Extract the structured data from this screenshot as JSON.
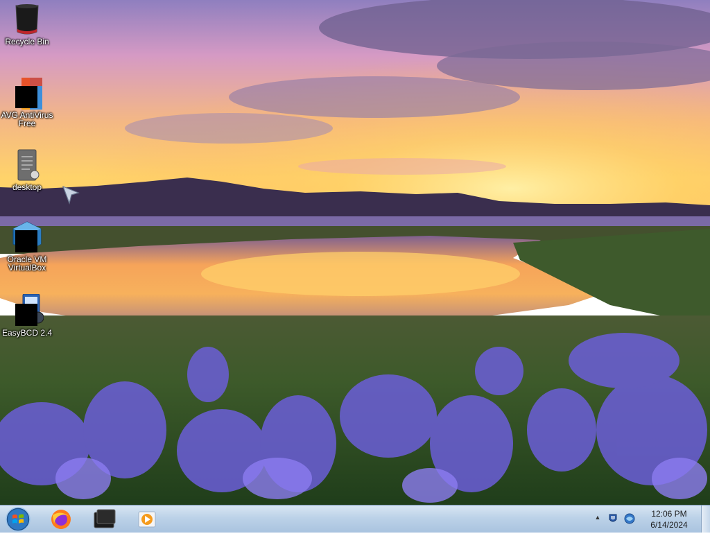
{
  "desktop": {
    "icons": [
      {
        "label": "Recycle Bin",
        "icon": "recycle-bin-icon"
      },
      {
        "label": "AVG AntiVirus\nFree",
        "icon": "avg-antivirus-icon"
      },
      {
        "label": "desktop",
        "icon": "document-file-icon"
      },
      {
        "label": "Oracle VM\nVirtualBox",
        "icon": "virtualbox-icon"
      },
      {
        "label": "EasyBCD 2.4",
        "icon": "easybcd-icon"
      }
    ]
  },
  "taskbar": {
    "start_icon": "windows-start-orb-icon",
    "pinned": [
      {
        "name": "firefox",
        "icon": "firefox-icon"
      },
      {
        "name": "cmd",
        "icon": "terminal-window-icon"
      },
      {
        "name": "media-player",
        "icon": "media-player-icon"
      }
    ],
    "tray": {
      "icons": [
        "show-hidden-icons-chevron-icon",
        "action-center-flag-icon",
        "network-icon"
      ],
      "chevron": "▲",
      "time": "12:06 PM",
      "date": "6/14/2024"
    }
  },
  "colors": {
    "taskbar_top": "#d8e6f3",
    "taskbar_bottom": "#a9c3df",
    "sky_top": "#8a78b8",
    "sunset": "#ffc64a",
    "flowers": "#6a5cd8"
  }
}
